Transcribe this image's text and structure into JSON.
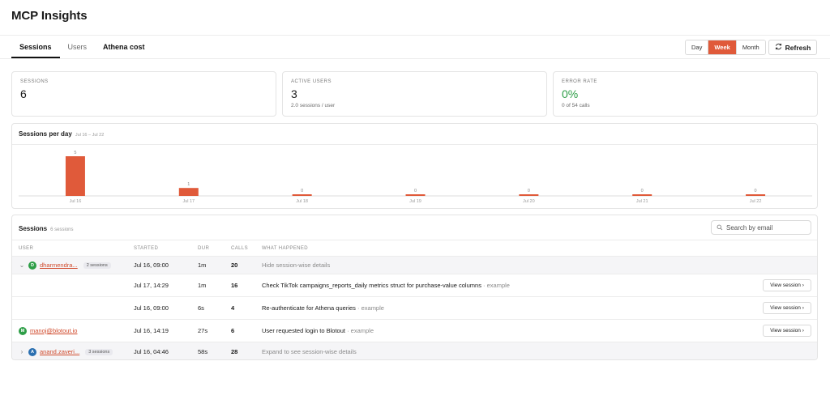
{
  "app": {
    "title": "MCP Insights"
  },
  "tabs": [
    {
      "label": "Sessions"
    },
    {
      "label": "Users"
    },
    {
      "label": "Athena cost"
    }
  ],
  "range": {
    "options": [
      "Day",
      "Week",
      "Month"
    ],
    "selected": "Week"
  },
  "refresh_label": "Refresh",
  "stats": {
    "sessions": {
      "label": "SESSIONS",
      "value": "6"
    },
    "active_users": {
      "label": "ACTIVE USERS",
      "value": "3",
      "sub": "2.0 sessions / user"
    },
    "error_rate": {
      "label": "ERROR RATE",
      "value": "0%",
      "sub": "0 of 54 calls",
      "color": "#2e9e47"
    }
  },
  "chart_panel": {
    "title": "Sessions per day",
    "subtitle": "Jul 16 – Jul 22"
  },
  "chart_data": {
    "type": "bar",
    "categories": [
      "Jul 16",
      "Jul 17",
      "Jul 18",
      "Jul 19",
      "Jul 20",
      "Jul 21",
      "Jul 22"
    ],
    "values": [
      5,
      1,
      0,
      0,
      0,
      0,
      0
    ],
    "title": "Sessions per day",
    "xlabel": "",
    "ylabel": "",
    "ylim": [
      0,
      5
    ],
    "grid": false,
    "bar_color": "#e05a3a"
  },
  "sessions_table": {
    "title": "Sessions",
    "count_label": "6 sessions",
    "search_placeholder": "Search by email",
    "columns": [
      "USER",
      "STARTED",
      "DUR",
      "CALLS",
      "WHAT HAPPENED"
    ],
    "view_label": "View session ›",
    "rows": [
      {
        "user": "dharmendra...",
        "avatar": "D",
        "avatar_color": "#2e9e47",
        "badge": "2 sessions",
        "expanded": true,
        "started": "Jul 16, 09:00",
        "dur": "1m",
        "calls": "20",
        "what": "Hide session-wise details"
      },
      {
        "started": "Jul 17, 14:29",
        "dur": "1m",
        "calls": "16",
        "what": "Check TikTok campaigns_reports_daily metrics struct for purchase-value columns",
        "tag": "· example"
      },
      {
        "started": "Jul 16, 09:00",
        "dur": "6s",
        "calls": "4",
        "what": "Re-authenticate for Athena queries",
        "tag": "· example"
      },
      {
        "user": "manoj@blotout.io",
        "avatar": "M",
        "avatar_color": "#2e9e47",
        "started": "Jul 16, 14:19",
        "dur": "27s",
        "calls": "6",
        "what": "User requested login to Blotout",
        "tag": "· example"
      },
      {
        "user": "anand.zaveri...",
        "avatar": "A",
        "avatar_color": "#2a6fb0",
        "badge": "3 sessions",
        "expanded": false,
        "started": "Jul 16, 04:46",
        "dur": "58s",
        "calls": "28",
        "what": "Expand to see session-wise details"
      }
    ]
  }
}
